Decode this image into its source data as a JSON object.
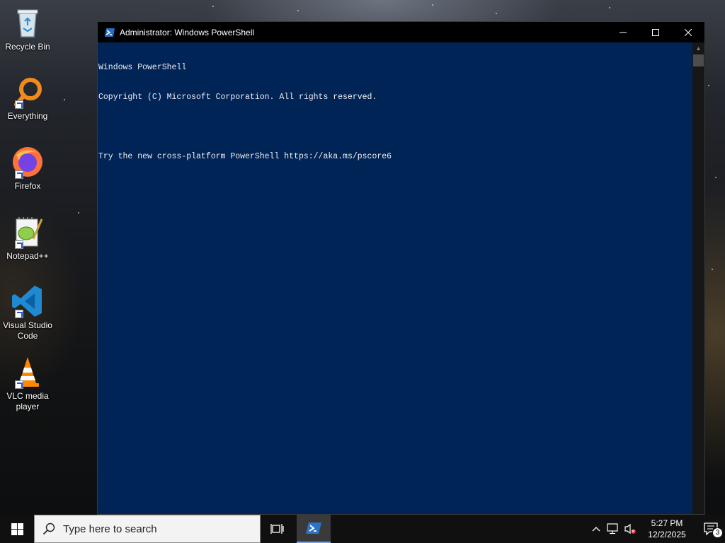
{
  "desktop": {
    "icons": [
      {
        "label": "Recycle Bin",
        "icon": "recycle-bin-icon"
      },
      {
        "label": "Everything",
        "icon": "magnifier-icon"
      },
      {
        "label": "Firefox",
        "icon": "firefox-icon"
      },
      {
        "label": "Notepad++",
        "icon": "notepad-plus-plus-icon"
      },
      {
        "label": "Visual Studio Code",
        "icon": "vscode-icon"
      },
      {
        "label": "VLC media player",
        "icon": "vlc-cone-icon"
      }
    ]
  },
  "window": {
    "title": "Administrator: Windows PowerShell",
    "background": "#012456",
    "console_lines": [
      "Windows PowerShell",
      "Copyright (C) Microsoft Corporation. All rights reserved.",
      "",
      "Try the new cross-platform PowerShell https://aka.ms/pscore6"
    ]
  },
  "taskbar": {
    "search_placeholder": "Type here to search",
    "clock_time": "5:27 PM",
    "clock_date": "12/2/2025",
    "notification_count": "3"
  }
}
